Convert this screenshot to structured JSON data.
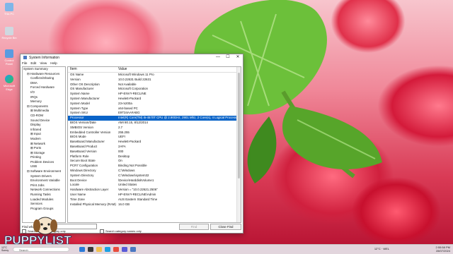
{
  "desktop": {
    "icons": [
      "This PC",
      "Recycle Bin",
      "Control Panel",
      "Microsoft Edge"
    ]
  },
  "window": {
    "title": "System Information",
    "controls": {
      "minimize": "—",
      "maximize": "☐",
      "close": "✕"
    },
    "menu": [
      "File",
      "Edit",
      "View",
      "Help"
    ]
  },
  "tree": [
    {
      "label": "System Summary",
      "level": 0
    },
    {
      "label": "⊟ Hardware Resources",
      "level": 1
    },
    {
      "label": "Conflicts/Sharing",
      "level": 2
    },
    {
      "label": "DMA",
      "level": 2
    },
    {
      "label": "Forced Hardware",
      "level": 2
    },
    {
      "label": "I/O",
      "level": 2
    },
    {
      "label": "IRQs",
      "level": 2
    },
    {
      "label": "Memory",
      "level": 2
    },
    {
      "label": "⊟ Components",
      "level": 1
    },
    {
      "label": "⊞ Multimedia",
      "level": 2
    },
    {
      "label": "CD-ROM",
      "level": 2
    },
    {
      "label": "Sound Device",
      "level": 2
    },
    {
      "label": "Display",
      "level": 2
    },
    {
      "label": "Infrared",
      "level": 2
    },
    {
      "label": "⊞ Input",
      "level": 2
    },
    {
      "label": "Modem",
      "level": 2
    },
    {
      "label": "⊞ Network",
      "level": 2
    },
    {
      "label": "⊞ Ports",
      "level": 2
    },
    {
      "label": "⊞ Storage",
      "level": 2
    },
    {
      "label": "Printing",
      "level": 2
    },
    {
      "label": "Problem Devices",
      "level": 2
    },
    {
      "label": "USB",
      "level": 2
    },
    {
      "label": "⊟ Software Environment",
      "level": 1
    },
    {
      "label": "System Drivers",
      "level": 2
    },
    {
      "label": "Environment Variable",
      "level": 2
    },
    {
      "label": "Print Jobs",
      "level": 2
    },
    {
      "label": "Network Connections",
      "level": 2
    },
    {
      "label": "Running Tasks",
      "level": 2
    },
    {
      "label": "Loaded Modules",
      "level": 2
    },
    {
      "label": "Services",
      "level": 2
    },
    {
      "label": "Program Groups",
      "level": 2
    }
  ],
  "table": {
    "headers": [
      "Item",
      "Value"
    ],
    "selected_index": 9,
    "rows": [
      [
        "OS Name",
        "Microsoft Windows 11 Pro"
      ],
      [
        "Version",
        "10.0.22631 Build 22631"
      ],
      [
        "Other OS Description",
        "Not Available"
      ],
      [
        "OS Manufacturer",
        "Microsoft Corporation"
      ],
      [
        "System Name",
        "HP-ENVY-RECLINE"
      ],
      [
        "System Manufacturer",
        "Hewlett-Packard"
      ],
      [
        "System Model",
        "23-m200a"
      ],
      [
        "System Type",
        "x64-based PC"
      ],
      [
        "System SKU",
        "E9T34AA#ABG"
      ],
      [
        "Processor",
        "Intel(R) Core(TM) i5-4570T CPU @ 2.90GHz, 2901 Mhz, 2 Core(s), 4 Logical Processor(s)"
      ],
      [
        "BIOS Version/Date",
        "AMI 80.15, 8/12/2014"
      ],
      [
        "SMBIOS Version",
        "2.7"
      ],
      [
        "Embedded Controller Version",
        "255.255"
      ],
      [
        "BIOS Mode",
        "UEFI"
      ],
      [
        "BaseBoard Manufacturer",
        "Hewlett-Packard"
      ],
      [
        "BaseBoard Product",
        "2AFA"
      ],
      [
        "BaseBoard Version",
        "000"
      ],
      [
        "Platform Role",
        "Desktop"
      ],
      [
        "Secure Boot State",
        "On"
      ],
      [
        "PCR7 Configuration",
        "Binding Not Possible"
      ],
      [
        "Windows Directory",
        "C:\\Windows"
      ],
      [
        "System Directory",
        "C:\\Windows\\system32"
      ],
      [
        "Boot Device",
        "\\Device\\HarddiskVolume1"
      ],
      [
        "Locale",
        "United States"
      ],
      [
        "Hardware Abstraction Layer",
        "Version = \"10.0.22621.2506\""
      ],
      [
        "User Name",
        "HP-ENVY-RECLINE\\Admin"
      ],
      [
        "Time Zone",
        "AUS Eastern Standard Time"
      ],
      [
        "Installed Physical Memory (RAM)",
        "16.0 GB"
      ]
    ]
  },
  "find": {
    "label": "Find what:",
    "value": "",
    "find_button": "Find",
    "close_button": "Close Find",
    "search_selected": "Search selected category only",
    "search_names": "Search category names only"
  },
  "taskbar": {
    "search_placeholder": "Search",
    "weather_temp": "12°C",
    "weather_desc": "Sunny",
    "tray_weather": "12°C · WEL",
    "time": "2:55:58 PM",
    "date": "28/07/2024"
  },
  "watermark": {
    "text": "PUPPYLIST"
  },
  "colors": {
    "selection": "#0a64c8",
    "taskbar": "#e6e6ec",
    "wallpaper_red": "#c8102e",
    "leaf_green": "#4fae2a"
  }
}
